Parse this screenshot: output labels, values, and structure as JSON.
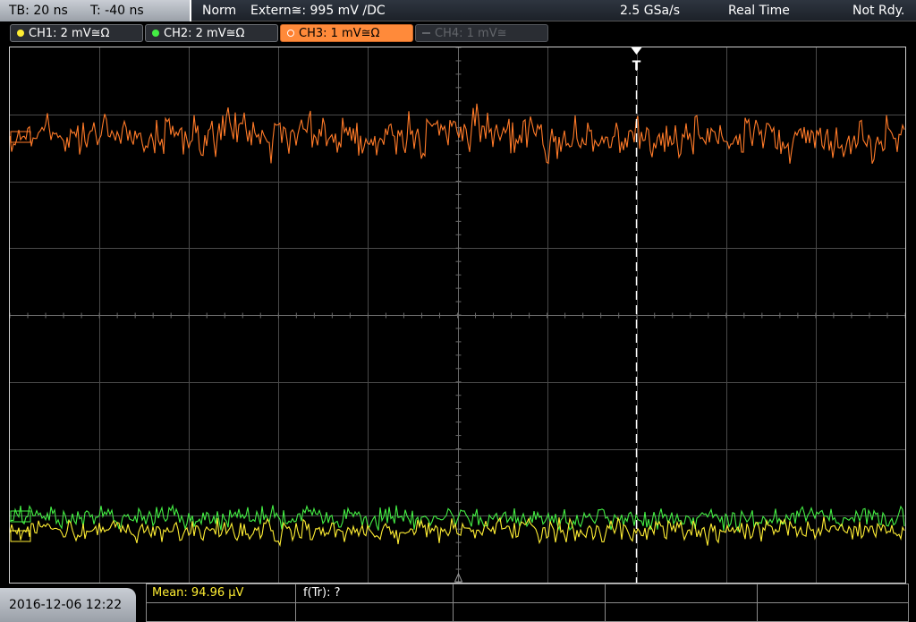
{
  "topbar": {
    "timebase": "TB: 20 ns",
    "trigger_offset": "T: -40 ns",
    "trigger_mode": "Norm",
    "trigger_source": "Extern≅: 995 mV ∕DC",
    "sample_rate": "2.5 GSa/s",
    "acq_mode": "Real Time",
    "status": "Not Rdy."
  },
  "channels": [
    {
      "label": "CH1: 2 mV≅Ω",
      "color": "#ffee33",
      "state": "off"
    },
    {
      "label": "CH2: 2 mV≅Ω",
      "color": "#44ee44",
      "state": "off"
    },
    {
      "label": "CH3: 1 mV≅Ω",
      "color": "#ff7a28",
      "state": "on"
    },
    {
      "label": "CH4: 1 mV≅",
      "color": "#62656a",
      "state": "disabled"
    }
  ],
  "trigger_marker": "T",
  "bottom": {
    "datetime": "2016-12-06 12:22",
    "mean_label": "Mean: 94.96 μV",
    "ftr_label": "f(Tr): ?"
  },
  "colors": {
    "ch1": "#ffee33",
    "ch2": "#44ee44",
    "ch3": "#ff7a28",
    "grid": "#4a4a4a",
    "mean_text": "#ffee33"
  }
}
